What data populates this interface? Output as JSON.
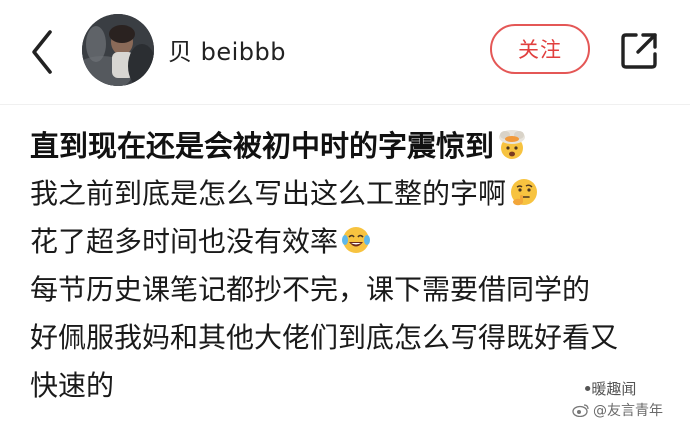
{
  "header": {
    "back_icon": "chevron-left-icon",
    "avatar_icon": "user-avatar",
    "username": "贝 beibbb",
    "follow_label": "关注",
    "share_icon": "share-external-icon",
    "accent_color": "#e13f3e"
  },
  "post": {
    "lines": [
      {
        "text": "直到现在还是会被初中时的字震惊到",
        "emoji": "exploding-head-emoji"
      },
      {
        "text": "我之前到底是怎么写出这么工整的字啊",
        "emoji": "thinking-face-emoji"
      },
      {
        "text": "花了超多时间也没有效率",
        "emoji": "tears-of-joy-emoji"
      },
      {
        "text": "每节历史课笔记都抄不完，课下需要借同学的"
      },
      {
        "text": "好佩服我妈和其他大佬们到底怎么写得既好看又"
      },
      {
        "text": "快速的"
      }
    ]
  },
  "watermark": {
    "line1": "暖趣闻",
    "line2": "@友言青年",
    "logo_icon": "weibo-logo-icon"
  }
}
